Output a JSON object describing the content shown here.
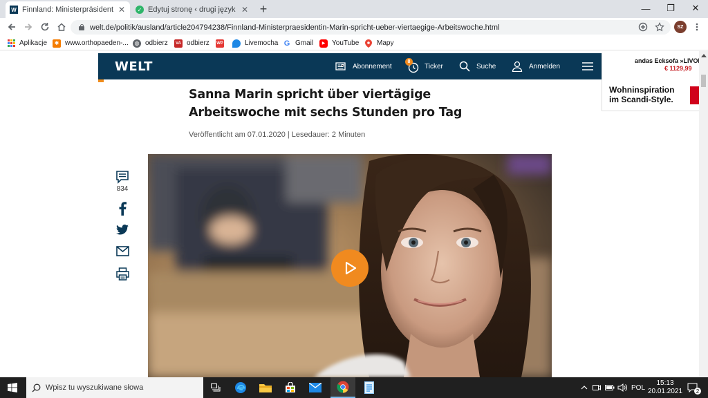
{
  "browser": {
    "tabs": [
      {
        "title": "Finnland: Ministerpräsidentin Ma",
        "favicon_text": "W",
        "favicon_color": "#0a3856"
      },
      {
        "title": "Edytuj stronę ‹ drugi język - niem",
        "favicon_text": "✓",
        "favicon_color": "#2fb56a"
      }
    ],
    "url": "welt.de/politik/ausland/article204794238/Finnland-Ministerpraesidentin-Marin-spricht-ueber-viertaegige-Arbeitswoche.html",
    "profile_initials": "SZ",
    "bookmarks": [
      {
        "label": "Aplikacje",
        "icon": "apps-grid-icon",
        "color": "#e53935"
      },
      {
        "label": "www.orthopaeden-...",
        "icon": "orthopaeden-icon",
        "color": "#f57c00"
      },
      {
        "label": "odbierz",
        "icon": "globe-icon",
        "color": "#5f6368"
      },
      {
        "label": "odbierz",
        "icon": "vaper-icon",
        "color": "#c62828"
      },
      {
        "label": "",
        "icon": "wp-icon",
        "color": "#e53935"
      },
      {
        "label": "Livemocha",
        "icon": "livemocha-icon",
        "color": "#1e88e5"
      },
      {
        "label": "Gmail",
        "icon": "google-icon",
        "color": "#4285f4"
      },
      {
        "label": "YouTube",
        "icon": "youtube-icon",
        "color": "#ff0000"
      },
      {
        "label": "Mapy",
        "icon": "maps-pin-icon",
        "color": "#34a853"
      }
    ]
  },
  "site": {
    "logo": "WELT",
    "nav": {
      "abonnement": "Abonnement",
      "ticker": "Ticker",
      "ticker_badge": "8",
      "suche": "Suche",
      "anmelden": "Anmelden"
    },
    "brand_color": "#0a3856",
    "accent_color": "#f08a1f"
  },
  "article": {
    "headline": "Sanna Marin spricht über viertägige Arbeitswoche mit sechs Stunden pro Tag",
    "meta": "Veröffentlicht am 07.01.2020 | Lesedauer: 2 Minuten",
    "comment_count": "834"
  },
  "ad": {
    "product": "andas Ecksofa »LIVOR",
    "price": "€ 1129,99",
    "tagline_line1": "Wohninspiration",
    "tagline_line2": "im Scandi-Style."
  },
  "taskbar": {
    "search_placeholder": "Wpisz tu wyszukiwane słowa",
    "language": "POL",
    "time": "15:13",
    "date": "20.01.2021",
    "notification_count": "2"
  }
}
